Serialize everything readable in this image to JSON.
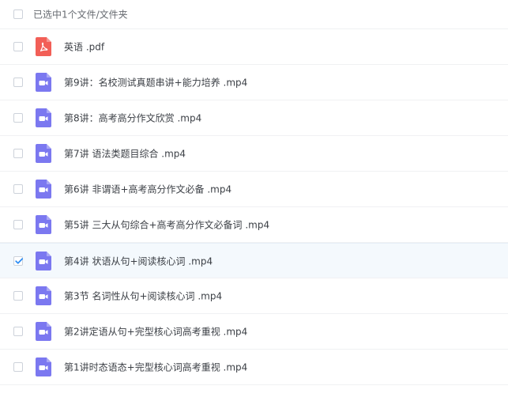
{
  "header": {
    "selection_text": "已选中1个文件/文件夹"
  },
  "files": [
    {
      "name": "英语 .pdf",
      "type": "pdf",
      "checked": false
    },
    {
      "name": "第9讲：名校测试真题串讲+能力培养 .mp4",
      "type": "video",
      "checked": false
    },
    {
      "name": "第8讲：高考高分作文欣赏 .mp4",
      "type": "video",
      "checked": false
    },
    {
      "name": "第7讲 语法类题目综合 .mp4",
      "type": "video",
      "checked": false
    },
    {
      "name": "第6讲 非谓语+高考高分作文必备 .mp4",
      "type": "video",
      "checked": false
    },
    {
      "name": "第5讲 三大从句综合+高考高分作文必备词 .mp4",
      "type": "video",
      "checked": false
    },
    {
      "name": "第4讲 状语从句+阅读核心词 .mp4",
      "type": "video",
      "checked": true
    },
    {
      "name": "第3节 名词性从句+阅读核心词 .mp4",
      "type": "video",
      "checked": false
    },
    {
      "name": "第2讲定语从句+完型核心词高考重视 .mp4",
      "type": "video",
      "checked": false
    },
    {
      "name": "第1讲时态语态+完型核心词高考重视 .mp4",
      "type": "video",
      "checked": false
    }
  ],
  "colors": {
    "pdf_icon": "#f25f57",
    "video_icon": "#7b78f0",
    "check": "#2f8ef4",
    "selected_row": "#f4f9fd"
  }
}
